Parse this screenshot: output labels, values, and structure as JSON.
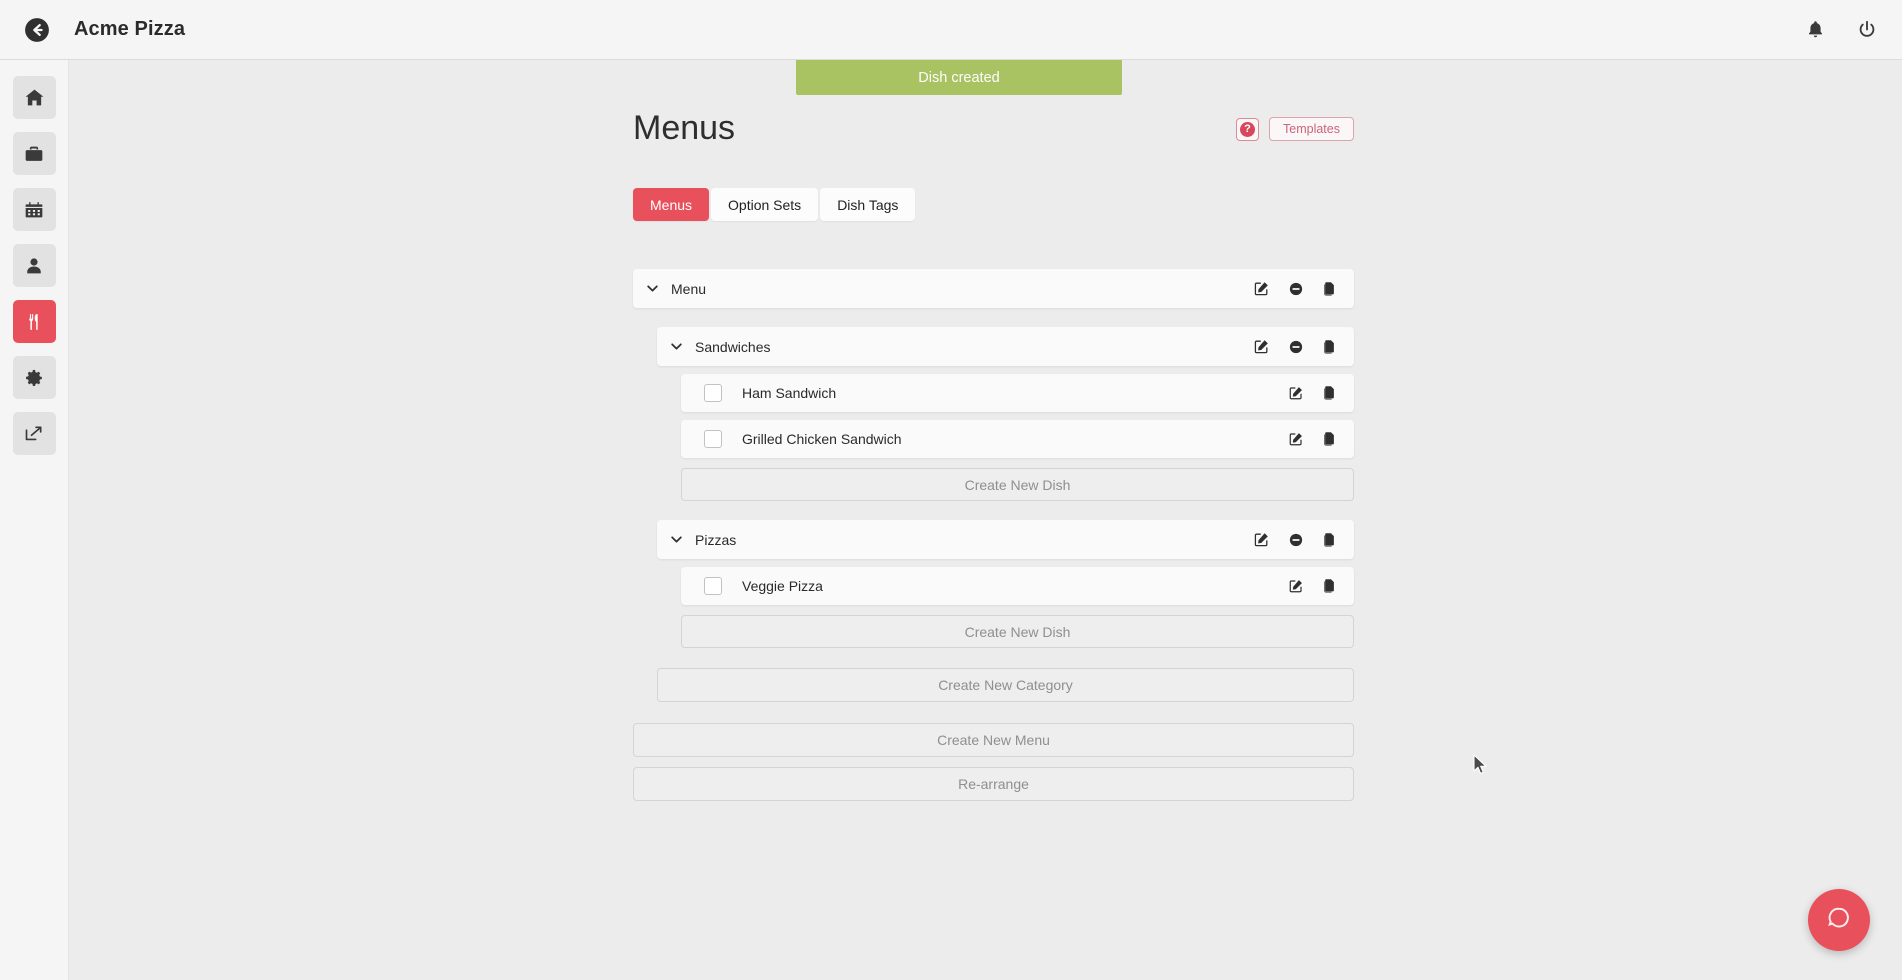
{
  "topbar": {
    "back_icon": "back-arrow-circle-icon",
    "app_title": "Acme Pizza",
    "notifications_icon": "bell-icon",
    "power_icon": "power-icon"
  },
  "sidebar": {
    "items": [
      {
        "icon": "home-icon",
        "name": "home",
        "active": false
      },
      {
        "icon": "briefcase-icon",
        "name": "orders",
        "active": false
      },
      {
        "icon": "calendar-icon",
        "name": "bookings",
        "active": false
      },
      {
        "icon": "person-icon",
        "name": "customers",
        "active": false
      },
      {
        "icon": "utensils-icon",
        "name": "menus",
        "active": true
      },
      {
        "icon": "gear-icon",
        "name": "settings",
        "active": false
      },
      {
        "icon": "external-link-icon",
        "name": "open-site",
        "active": false
      }
    ]
  },
  "toast": {
    "message": "Dish created",
    "color": "#a9c262"
  },
  "page": {
    "title": "Menus",
    "help_label": "?",
    "templates_label": "Templates"
  },
  "tabs": [
    {
      "label": "Menus",
      "active": true
    },
    {
      "label": "Option Sets",
      "active": false
    },
    {
      "label": "Dish Tags",
      "active": false
    }
  ],
  "tree": {
    "menu": {
      "label": "Menu",
      "caret": "chevron-down-icon",
      "actions": [
        "edit-icon",
        "remove-icon",
        "duplicate-icon"
      ]
    },
    "categories": [
      {
        "label": "Sandwiches",
        "caret": "chevron-down-icon",
        "actions": [
          "edit-icon",
          "remove-icon",
          "duplicate-icon"
        ],
        "dishes": [
          {
            "label": "Ham Sandwich",
            "checked": false,
            "actions": [
              "edit-icon",
              "duplicate-icon"
            ]
          },
          {
            "label": "Grilled Chicken Sandwich",
            "checked": false,
            "actions": [
              "edit-icon",
              "duplicate-icon"
            ]
          }
        ],
        "create_dish_label": "Create New Dish"
      },
      {
        "label": "Pizzas",
        "caret": "chevron-down-icon",
        "actions": [
          "edit-icon",
          "remove-icon",
          "duplicate-icon"
        ],
        "dishes": [
          {
            "label": "Veggie Pizza",
            "checked": false,
            "actions": [
              "edit-icon",
              "duplicate-icon"
            ]
          }
        ],
        "create_dish_label": "Create New Dish"
      }
    ],
    "create_category_label": "Create New Category",
    "create_menu_label": "Create New Menu",
    "rearrange_label": "Re-arrange"
  },
  "support": {
    "icon": "chat-bubble-icon"
  },
  "theme": {
    "accent": "#e8505b",
    "toast_green": "#a9c262",
    "page_bg": "#ececec",
    "panel_bg": "#f5f5f5",
    "row_bg": "#fafafa"
  }
}
